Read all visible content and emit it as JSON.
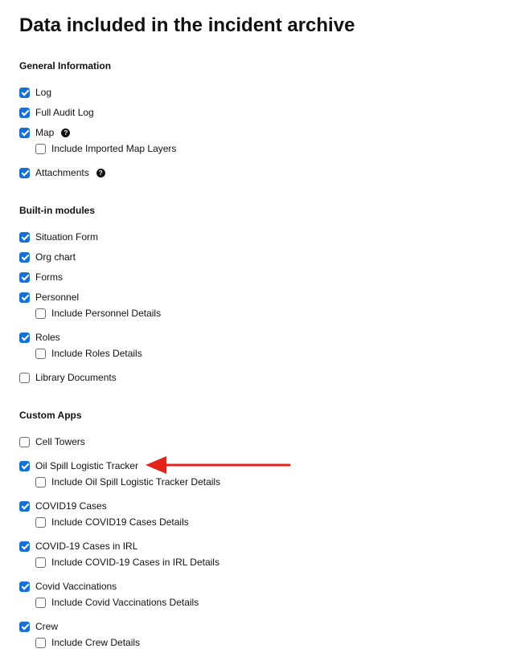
{
  "title": "Data included in the incident archive",
  "sections": {
    "general": {
      "title": "General Information",
      "log": "Log",
      "full_audit_log": "Full Audit Log",
      "map": "Map",
      "include_imported_map_layers": "Include Imported Map Layers",
      "attachments": "Attachments"
    },
    "builtin": {
      "title": "Built-in modules",
      "situation_form": "Situation Form",
      "org_chart": "Org chart",
      "forms": "Forms",
      "personnel": "Personnel",
      "include_personnel_details": "Include Personnel Details",
      "roles": "Roles",
      "include_roles_details": "Include Roles Details",
      "library_documents": "Library Documents"
    },
    "custom": {
      "title": "Custom Apps",
      "cell_towers": "Cell Towers",
      "oil_spill": "Oil Spill Logistic Tracker",
      "include_oil_spill_details": "Include Oil Spill Logistic Tracker Details",
      "covid19_cases": "COVID19 Cases",
      "include_covid19_cases_details": "Include COVID19 Cases Details",
      "covid19_irl": "COVID-19 Cases in IRL",
      "include_covid19_irl_details": "Include COVID-19 Cases in IRL Details",
      "covid_vaccinations": "Covid Vaccinations",
      "include_covid_vaccinations_details": "Include Covid Vaccinations Details",
      "crew": "Crew",
      "include_crew_details": "Include Crew Details"
    }
  },
  "help_glyph": "?",
  "colors": {
    "checkbox_checked": "#1670d6",
    "arrow": "#e5231b"
  },
  "icons": {
    "help": "question-circle-icon",
    "annotation": "red-arrow-icon"
  }
}
